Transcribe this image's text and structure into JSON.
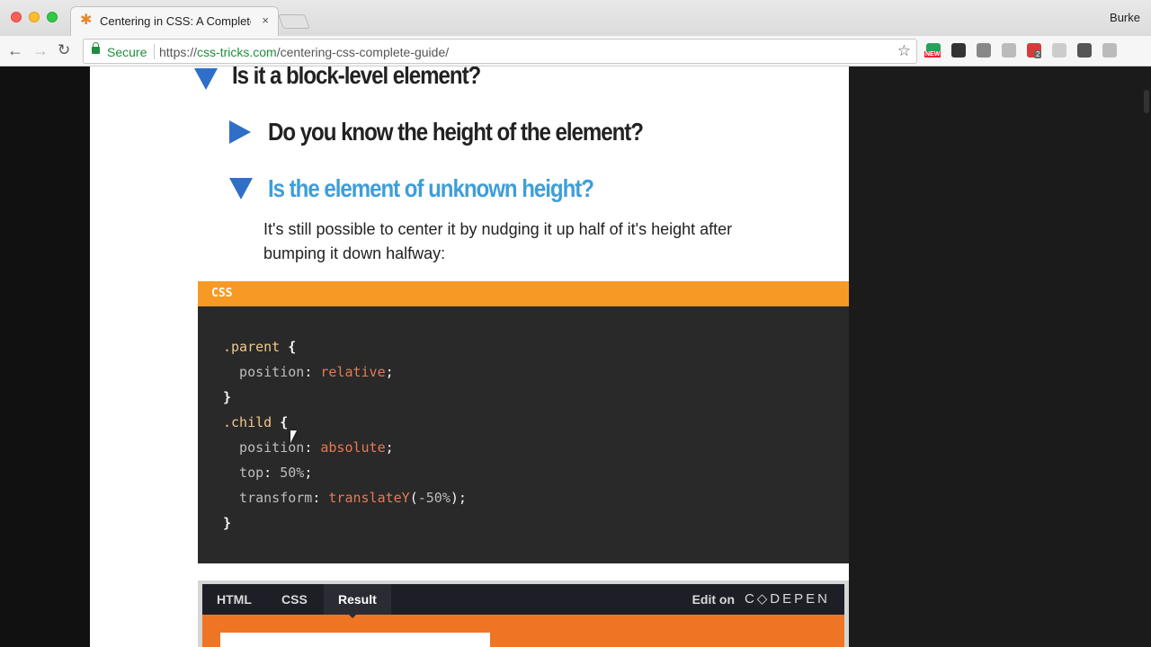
{
  "browser": {
    "tab_title": "Centering in CSS: A Complete Guide",
    "tab_close": "×",
    "user": "Burke",
    "secure_label": "Secure",
    "url_scheme": "https://",
    "url_host": "css-tricks.com",
    "url_path": "/centering-css-complete-guide/",
    "nav": {
      "back": "←",
      "forward": "→",
      "reload": "↻"
    },
    "star": "☆",
    "extensions": [
      {
        "name": "new-badge-extension-icon",
        "color": "#22a35a",
        "label": "NEW"
      },
      {
        "name": "buffer-extension-icon",
        "color": "#333333"
      },
      {
        "name": "vue-devtools-extension-icon",
        "color": "#888888"
      },
      {
        "name": "y-extension-icon",
        "color": "#bbbbbb"
      },
      {
        "name": "ublock-extension-icon",
        "color": "#d63a3a",
        "badge": "2"
      },
      {
        "name": "mail-extension-icon",
        "color": "#cccccc"
      },
      {
        "name": "puzzle-extension-icon",
        "color": "#555555"
      },
      {
        "name": "s-extension-icon",
        "color": "#bbbbbb"
      }
    ]
  },
  "article": {
    "q1": "Is it a block-level element?",
    "q2": "Do you know the height of the element?",
    "q3": "Is the element of unknown height?",
    "description": "It's still possible to center it by nudging it up half of it's height after bumping it down halfway:",
    "accent_color": "#3e9ed9",
    "arrow_color": "#2f6fc9"
  },
  "code_block": {
    "language": "CSS",
    "lines": [
      [
        {
          "t": ".parent",
          "c": "sel"
        },
        {
          "t": " ",
          "c": "punct"
        },
        {
          "t": "{",
          "c": "brace"
        }
      ],
      [
        {
          "t": "  position",
          "c": "prop"
        },
        {
          "t": ": ",
          "c": "punct"
        },
        {
          "t": "relative",
          "c": "val"
        },
        {
          "t": ";",
          "c": "punct"
        }
      ],
      [
        {
          "t": "}",
          "c": "brace"
        }
      ],
      [
        {
          "t": ".child",
          "c": "sel"
        },
        {
          "t": " ",
          "c": "punct"
        },
        {
          "t": "{",
          "c": "brace"
        }
      ],
      [
        {
          "t": "  position",
          "c": "prop"
        },
        {
          "t": ": ",
          "c": "punct"
        },
        {
          "t": "absolute",
          "c": "val"
        },
        {
          "t": ";",
          "c": "punct"
        }
      ],
      [
        {
          "t": "  top",
          "c": "prop"
        },
        {
          "t": ": ",
          "c": "punct"
        },
        {
          "t": "50%",
          "c": "num"
        },
        {
          "t": ";",
          "c": "punct"
        }
      ],
      [
        {
          "t": "  transform",
          "c": "prop"
        },
        {
          "t": ": ",
          "c": "punct"
        },
        {
          "t": "translateY",
          "c": "val"
        },
        {
          "t": "(",
          "c": "punct"
        },
        {
          "t": "-50%",
          "c": "num"
        },
        {
          "t": ");",
          "c": "punct"
        }
      ],
      [
        {
          "t": "}",
          "c": "brace"
        }
      ]
    ]
  },
  "codepen": {
    "tabs": [
      "HTML",
      "CSS",
      "Result"
    ],
    "active_tab": "Result",
    "edit_on": "Edit on",
    "logo": "C◇DEPEN"
  }
}
